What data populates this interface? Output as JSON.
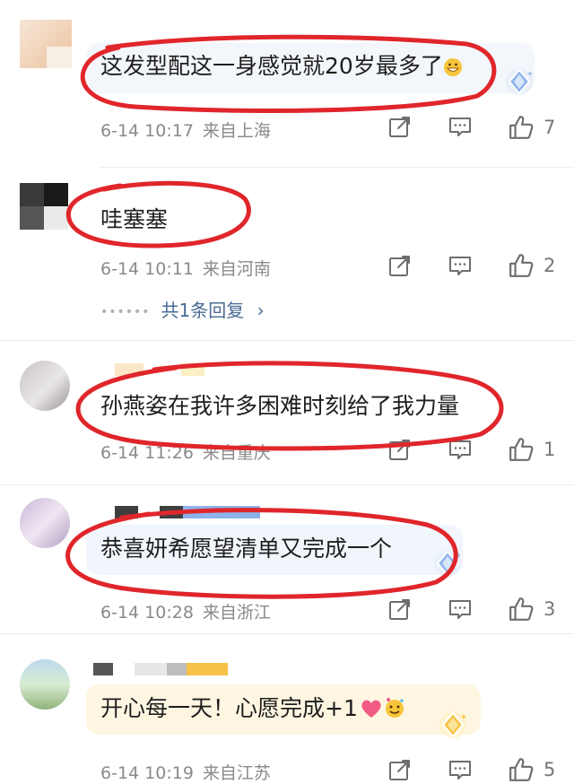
{
  "comments": [
    {
      "text": "这发型配这一身感觉就20岁最多了",
      "time": "6-14 10:17",
      "location": "来自上海",
      "likes": "7"
    },
    {
      "text": "哇塞塞",
      "time": "6-14 10:11",
      "location": "来自河南",
      "likes": "2",
      "replies": "共1条回复"
    },
    {
      "text": "孙燕姿在我许多困难时刻给了我力量",
      "time": "6-14 11:26",
      "location": "来自重庆",
      "likes": "1"
    },
    {
      "text": "恭喜妍希愿望清单又完成一个",
      "time": "6-14 10:28",
      "location": "来自浙江",
      "likes": "3"
    },
    {
      "text": "开心每一天！心愿完成+1",
      "time": "6-14 10:19",
      "location": "来自江苏",
      "likes": "5"
    }
  ],
  "icons": {
    "share": "share-icon",
    "comment": "comment-icon",
    "like": "thumbs-up-icon",
    "chevron": "chevron-right-icon",
    "badge": "diamond-badge-icon"
  },
  "colors": {
    "annotation_red": "#e0262b",
    "reply_link": "#4a6a92",
    "meta_gray": "#8a8a8a",
    "bubble_tint": "#eef3fb"
  }
}
